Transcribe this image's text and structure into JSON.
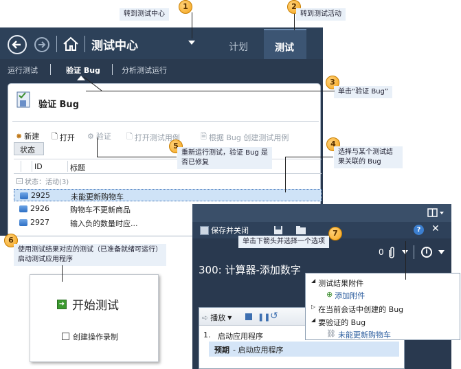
{
  "callouts": [
    {
      "num": "1",
      "text": "转到测试中心"
    },
    {
      "num": "2",
      "text": "转到测试活动"
    },
    {
      "num": "3",
      "text": "单击“验证 Bug”"
    },
    {
      "num": "4",
      "text": "选择与某个测试结果关联的 Bug"
    },
    {
      "num": "5",
      "text": "重新运行测试，验证 Bug 是否已修复"
    },
    {
      "num": "6",
      "text": "使用测试结果对应的测试（已准备就绪可运行）启动测试应用程序"
    },
    {
      "num": "7",
      "text": "单击下箭头并选择一个选项"
    }
  ],
  "header": {
    "title": "测试中心",
    "tab_plan": "计划",
    "tab_test": "测试"
  },
  "subnav": {
    "run": "运行测试",
    "verify": "验证 Bug",
    "analyze": "分析测试运行"
  },
  "panel": {
    "title": "验证 Bug",
    "toolbar": {
      "new": "新建",
      "open": "打开",
      "verify": "验证",
      "open_case": "打开测试用例",
      "create_case": "根据 Bug 创建测试用例"
    },
    "status_btn": "状态",
    "columns": [
      "ID",
      "标题"
    ],
    "group": "状态：活动(3)",
    "rows": [
      {
        "id": "2925",
        "title": "未能更新购物车"
      },
      {
        "id": "2926",
        "title": "购物车不更新商品"
      },
      {
        "id": "2927",
        "title": "输入负的数量时应..."
      }
    ]
  },
  "start": {
    "title": "开始测试",
    "checkbox": "创建操作录制"
  },
  "runner": {
    "save_close": "保存并关闭",
    "count": "0",
    "heading": "300: 计算器-添加数字",
    "play": "播放",
    "step_num": "1.",
    "step": "启动应用程序",
    "expected_label": "预期",
    "expected": "- 启动应用程序"
  },
  "menu": {
    "attachments": "测试结果附件",
    "add_attachment": "添加附件",
    "created": "在当前会话中创建的 Bug",
    "to_verify": "要验证的 Bug",
    "bug_item": "未能更新购物车"
  }
}
